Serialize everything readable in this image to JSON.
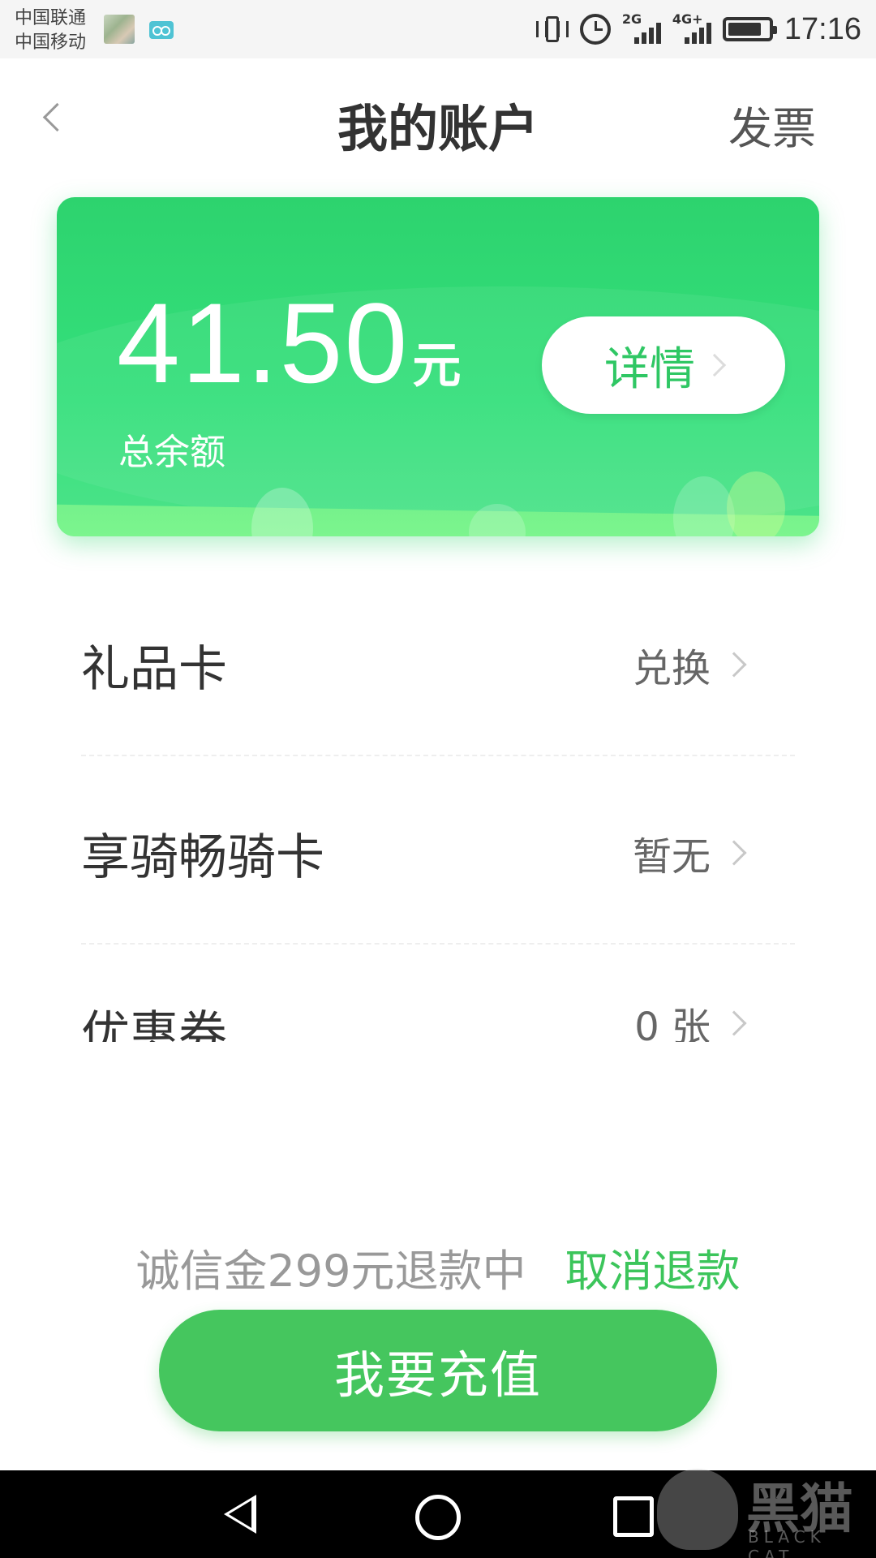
{
  "status_bar": {
    "carrier_1": "中国联通",
    "carrier_2": "中国移动",
    "network_1": "2G",
    "network_2": "4G+",
    "time": "17:16",
    "icons": [
      "gallery-thumbnail-icon",
      "voicemail-icon",
      "vibrate-icon",
      "alarm-icon",
      "signal-icon",
      "battery-icon"
    ]
  },
  "header": {
    "title": "我的账户",
    "invoice_label": "发票"
  },
  "balance_card": {
    "amount": "41.50",
    "unit": "元",
    "label": "总余额",
    "detail_button": "详情",
    "accent_color": "#2dd36e"
  },
  "list": [
    {
      "label": "礼品卡",
      "value": "兑换"
    },
    {
      "label": "享骑畅骑卡",
      "value": "暂无"
    },
    {
      "label": "优惠券",
      "value": "0 张"
    }
  ],
  "footer": {
    "refund_text": "诚信金299元退款中",
    "cancel_refund": "取消退款",
    "recharge_button": "我要充值",
    "cancel_color": "#3cc55b"
  },
  "watermark": {
    "text_cn": "黑猫",
    "text_en": "BLACK CAT"
  }
}
